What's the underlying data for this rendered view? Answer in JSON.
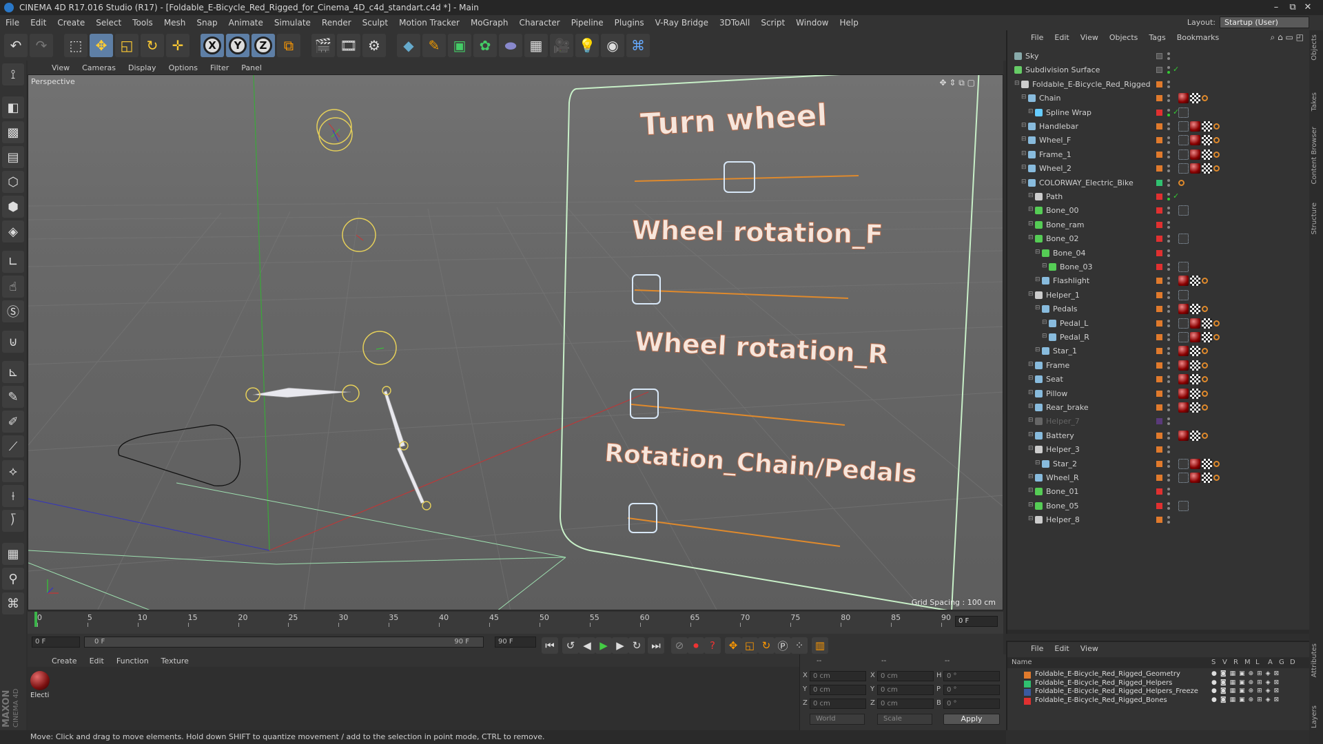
{
  "titlebar": {
    "title": "CINEMA 4D R17.016 Studio (R17) - [Foldable_E-Bicycle_Red_Rigged_for_Cinema_4D_c4d_standart.c4d *] - Main",
    "minimize": "–",
    "restore": "⧉",
    "close": "✕"
  },
  "menubar": [
    "File",
    "Edit",
    "Create",
    "Select",
    "Tools",
    "Mesh",
    "Snap",
    "Animate",
    "Simulate",
    "Render",
    "Sculpt",
    "Motion Tracker",
    "MoGraph",
    "Character",
    "Pipeline",
    "Plugins",
    "V-Ray Bridge",
    "3DToAll",
    "Script",
    "Window",
    "Help"
  ],
  "layout": {
    "label": "Layout:",
    "value": "Startup (User)"
  },
  "toolbar": {
    "x_axis": "X",
    "y_axis": "Y",
    "z_axis": "Z"
  },
  "viewport": {
    "menu": [
      "View",
      "Cameras",
      "Display",
      "Options",
      "Filter",
      "Panel"
    ],
    "label": "Perspective",
    "grid_spacing": "Grid Spacing : 100 cm",
    "controls": [
      "Turn wheel",
      "Wheel rotation_F",
      "Wheel rotation_R",
      "Rotation_Chain/Pedals"
    ]
  },
  "timeline": {
    "ticks": [
      "0",
      "5",
      "10",
      "15",
      "20",
      "25",
      "30",
      "35",
      "40",
      "45",
      "50",
      "55",
      "60",
      "65",
      "70",
      "75",
      "80",
      "85",
      "90"
    ],
    "current_frame": "0 F"
  },
  "transport": {
    "start_field": "0 F",
    "range_start": "0 F",
    "range_end": "90 F",
    "end_field": "90 F"
  },
  "material_manager": {
    "menu": [
      "Create",
      "Edit",
      "Function",
      "Texture"
    ],
    "material_name": "Electi"
  },
  "coordinates": {
    "header_left": "--",
    "header_mid": "--",
    "header_right": "--",
    "rows": [
      {
        "axis": "X",
        "pos": "0 cm",
        "size_axis": "X",
        "size": "0 cm",
        "rot_axis": "H",
        "rot": "0 °"
      },
      {
        "axis": "Y",
        "pos": "0 cm",
        "size_axis": "Y",
        "size": "0 cm",
        "rot_axis": "P",
        "rot": "0 °"
      },
      {
        "axis": "Z",
        "pos": "0 cm",
        "size_axis": "Z",
        "size": "0 cm",
        "rot_axis": "B",
        "rot": "0 °"
      }
    ],
    "mode": "World",
    "scale_mode": "Scale",
    "apply": "Apply"
  },
  "status": "Move: Click and drag to move elements. Hold down SHIFT to quantize movement / add to the selection in point mode, CTRL to remove.",
  "object_manager": {
    "menu": [
      "File",
      "Edit",
      "View",
      "Objects",
      "Tags",
      "Bookmarks"
    ],
    "objects": [
      {
        "name": "Sky",
        "indent": 0,
        "icon": "#8aa",
        "layer": "",
        "check": "grey",
        "tags": []
      },
      {
        "name": "Subdivision Surface",
        "indent": 0,
        "icon": "#6c6",
        "layer": "",
        "check": "green",
        "tags": []
      },
      {
        "name": "Foldable_E-Bicycle_Red_Rigged",
        "indent": 1,
        "icon": "#ccc",
        "layer": "#e07a2c",
        "check": "grey",
        "tags": []
      },
      {
        "name": "Chain",
        "indent": 2,
        "icon": "#8bd",
        "layer": "#e07a2c",
        "check": "grey",
        "tags": [
          "mat",
          "chk",
          "bn"
        ]
      },
      {
        "name": "Spline Wrap",
        "indent": 3,
        "icon": "#6cf",
        "layer": "#e03030",
        "check": "green",
        "tags": [
          "ik"
        ]
      },
      {
        "name": "Handlebar",
        "indent": 2,
        "icon": "#8bd",
        "layer": "#e07a2c",
        "check": "grey",
        "tags": [
          "ik",
          "mat",
          "chk",
          "bn"
        ]
      },
      {
        "name": "Wheel_F",
        "indent": 2,
        "icon": "#8bd",
        "layer": "#e07a2c",
        "check": "grey",
        "tags": [
          "ik",
          "mat",
          "chk",
          "bn"
        ]
      },
      {
        "name": "Frame_1",
        "indent": 2,
        "icon": "#8bd",
        "layer": "#e07a2c",
        "check": "grey",
        "tags": [
          "ik",
          "mat",
          "chk",
          "bn"
        ]
      },
      {
        "name": "Wheel_2",
        "indent": 2,
        "icon": "#8bd",
        "layer": "#e07a2c",
        "check": "grey",
        "tags": [
          "ik",
          "mat",
          "chk",
          "bn"
        ]
      },
      {
        "name": "COLORWAY_Electric_Bike",
        "indent": 2,
        "icon": "#8bd",
        "layer": "#30c070",
        "check": "grey",
        "tags": [
          "bn"
        ]
      },
      {
        "name": "Path",
        "indent": 3,
        "icon": "#ccc",
        "layer": "#e03030",
        "check": "green",
        "tags": []
      },
      {
        "name": "Bone_00",
        "indent": 3,
        "icon": "#5c5",
        "layer": "#e03030",
        "check": "grey",
        "tags": [
          "ik"
        ]
      },
      {
        "name": "Bone_ram",
        "indent": 3,
        "icon": "#5c5",
        "layer": "#e03030",
        "check": "grey",
        "tags": []
      },
      {
        "name": "Bone_02",
        "indent": 3,
        "icon": "#5c5",
        "layer": "#e03030",
        "check": "grey",
        "tags": [
          "ik"
        ]
      },
      {
        "name": "Bone_04",
        "indent": 4,
        "icon": "#5c5",
        "layer": "#e03030",
        "check": "grey",
        "tags": []
      },
      {
        "name": "Bone_03",
        "indent": 5,
        "icon": "#5c5",
        "layer": "#e03030",
        "check": "grey",
        "tags": [
          "ik"
        ]
      },
      {
        "name": "Flashlight",
        "indent": 4,
        "icon": "#8bd",
        "layer": "#e07a2c",
        "check": "grey",
        "tags": [
          "mat",
          "chk",
          "bn"
        ]
      },
      {
        "name": "Helper_1",
        "indent": 3,
        "icon": "#ccc",
        "layer": "#e07a2c",
        "check": "grey",
        "tags": [
          "ik"
        ]
      },
      {
        "name": "Pedals",
        "indent": 4,
        "icon": "#8bd",
        "layer": "#e07a2c",
        "check": "grey",
        "tags": [
          "mat",
          "chk",
          "bn"
        ]
      },
      {
        "name": "Pedal_L",
        "indent": 5,
        "icon": "#8bd",
        "layer": "#e07a2c",
        "check": "grey",
        "tags": [
          "ik",
          "mat",
          "chk",
          "bn"
        ]
      },
      {
        "name": "Pedal_R",
        "indent": 5,
        "icon": "#8bd",
        "layer": "#e07a2c",
        "check": "grey",
        "tags": [
          "ik",
          "mat",
          "chk",
          "bn"
        ]
      },
      {
        "name": "Star_1",
        "indent": 4,
        "icon": "#8bd",
        "layer": "#e07a2c",
        "check": "grey",
        "tags": [
          "mat",
          "chk",
          "bn"
        ]
      },
      {
        "name": "Frame",
        "indent": 3,
        "icon": "#8bd",
        "layer": "#e07a2c",
        "check": "grey",
        "tags": [
          "mat",
          "chk",
          "bn"
        ]
      },
      {
        "name": "Seat",
        "indent": 3,
        "icon": "#8bd",
        "layer": "#e07a2c",
        "check": "grey",
        "tags": [
          "mat",
          "chk",
          "bn"
        ]
      },
      {
        "name": "Pillow",
        "indent": 3,
        "icon": "#8bd",
        "layer": "#e07a2c",
        "check": "grey",
        "tags": [
          "mat",
          "chk",
          "bn"
        ]
      },
      {
        "name": "Rear_brake",
        "indent": 3,
        "icon": "#8bd",
        "layer": "#e07a2c",
        "check": "grey",
        "tags": [
          "mat",
          "chk",
          "bn"
        ]
      },
      {
        "name": "Helper_7",
        "indent": 3,
        "icon": "#666",
        "layer": "#5a3a7a",
        "check": "grey",
        "tags": []
      },
      {
        "name": "Battery",
        "indent": 3,
        "icon": "#8bd",
        "layer": "#e07a2c",
        "check": "grey",
        "tags": [
          "mat",
          "chk",
          "bn"
        ]
      },
      {
        "name": "Helper_3",
        "indent": 3,
        "icon": "#ccc",
        "layer": "#e07a2c",
        "check": "grey",
        "tags": []
      },
      {
        "name": "Star_2",
        "indent": 4,
        "icon": "#8bd",
        "layer": "#e07a2c",
        "check": "grey",
        "tags": [
          "ik",
          "mat",
          "chk",
          "bn"
        ]
      },
      {
        "name": "Wheel_R",
        "indent": 3,
        "icon": "#8bd",
        "layer": "#e07a2c",
        "check": "grey",
        "tags": [
          "ik",
          "mat",
          "chk",
          "bn"
        ]
      },
      {
        "name": "Bone_01",
        "indent": 3,
        "icon": "#5c5",
        "layer": "#e03030",
        "check": "grey",
        "tags": []
      },
      {
        "name": "Bone_05",
        "indent": 3,
        "icon": "#5c5",
        "layer": "#e03030",
        "check": "grey",
        "tags": [
          "ik"
        ]
      },
      {
        "name": "Helper_8",
        "indent": 3,
        "icon": "#ccc",
        "layer": "#e07a2c",
        "check": "grey",
        "tags": []
      }
    ]
  },
  "layer_manager": {
    "menu": [
      "File",
      "Edit",
      "View"
    ],
    "columns": [
      "Name",
      "S",
      "V",
      "R",
      "M",
      "L",
      "A",
      "G",
      "D"
    ],
    "layers": [
      {
        "name": "Foldable_E-Bicycle_Red_Rigged_Geometry",
        "color": "#e07a2c"
      },
      {
        "name": "Foldable_E-Bicycle_Red_Rigged_Helpers",
        "color": "#30c070"
      },
      {
        "name": "Foldable_E-Bicycle_Red_Rigged_Helpers_Freeze",
        "color": "#3a5aa0"
      },
      {
        "name": "Foldable_E-Bicycle_Red_Rigged_Bones",
        "color": "#e03030"
      }
    ]
  },
  "side_tabs": [
    "Objects",
    "Takes",
    "Content Browser",
    "Structure",
    "Attributes",
    "Layers"
  ],
  "branding": {
    "maxon": "MAXON",
    "cinema": "CINEMA 4D"
  }
}
